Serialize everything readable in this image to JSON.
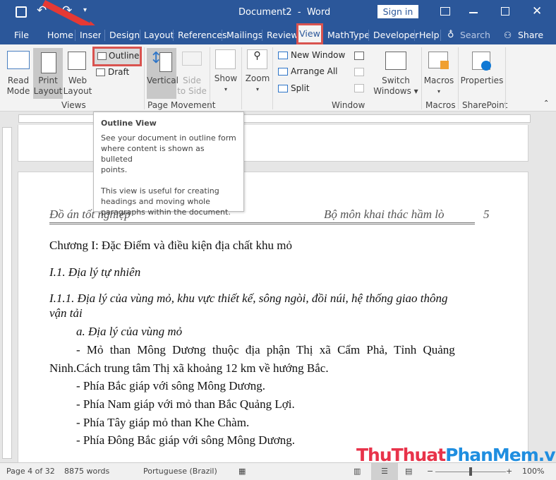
{
  "title_bar": {
    "title": "Document2  -  Word",
    "sign_in": "Sign in",
    "icons": [
      "save-icon",
      "undo-icon",
      "redo-icon",
      "customize-icon",
      "ribbon-display-icon",
      "minimize-icon",
      "maximize-icon",
      "close-icon"
    ]
  },
  "tabs": [
    "File",
    "Home",
    "Insert",
    "Design",
    "Layout",
    "References",
    "Mailings",
    "Review",
    "View",
    "MathType",
    "Developer",
    "Help"
  ],
  "search_label": "Search",
  "share_label": "Share",
  "active_tab": "View",
  "ribbon": {
    "views": {
      "read_mode": "Read Mode",
      "read_mode_l1": "Read",
      "read_mode_l2": "Mode",
      "print_l1": "Print",
      "print_l2": "Layout",
      "web_l1": "Web",
      "web_l2": "Layout",
      "outline": "Outline",
      "draft": "Draft",
      "group": "Views"
    },
    "page_movement": {
      "vertical": "Vertical",
      "side_l1": "Side",
      "side_l2": "to Side",
      "group": "Page Movement"
    },
    "show": "Show",
    "zoom": "Zoom",
    "window": {
      "new_window": "New Window",
      "arrange_all": "Arrange All",
      "split": "Split",
      "switch_l1": "Switch",
      "switch_l2": "Windows",
      "group": "Window"
    },
    "macros": {
      "label": "Macros",
      "group": "Macros"
    },
    "sharepoint": {
      "label": "Properties",
      "group": "SharePoint"
    }
  },
  "tooltip": {
    "title": "Outline View",
    "p1": [
      "See your document in outline form",
      "where content is shown as bulleted",
      "points."
    ],
    "p2": [
      "This view is useful for creating",
      "headings and moving whole",
      "paragraphs within the document."
    ]
  },
  "document": {
    "header_left": "Đồ án tốt nghiệp",
    "header_right": "Bộ môn khai thác hầm lò",
    "page_number": "5",
    "lines": [
      "Chương I: Đặc Điểm và điều kiện địa chất khu mỏ",
      "I.1. Địa lý tự  nhiên",
      "I.1.1. Địa lý của vùng mỏ, khu vực thiết kế, sông ngòi, đồi núi, hệ thống giao thông",
      "vận tải",
      "a. Địa lý của vùng mỏ",
      "- Mỏ than Mông Dương thuộc địa phận Thị xã Cẩm Phả, Tỉnh Quảng",
      "Ninh.Cách trung tâm Thị xã khoảng 12 km về hướng Bắc.",
      "- Phía Bắc giáp với sông Mông Dương.",
      "- Phía Nam giáp với mỏ than Bắc Quảng Lợi.",
      "- Phía Tây giáp mỏ than Khe Chàm.",
      "- Phía Đông Bắc giáp với sông Mông Dương."
    ]
  },
  "watermark": {
    "part1": "ThuThuat",
    "part2": "PhanMem",
    "part3": ".vn"
  },
  "status": {
    "page": "Page 4 of 32",
    "words": "8875 words",
    "language": "Portuguese (Brazil)",
    "zoom": "100%",
    "zoom_percent": 100
  },
  "colors": {
    "title_bar": "#2b579a",
    "highlight": "#d9534f",
    "watermark_red": "#e8334a",
    "watermark_blue": "#1f8ee0"
  }
}
